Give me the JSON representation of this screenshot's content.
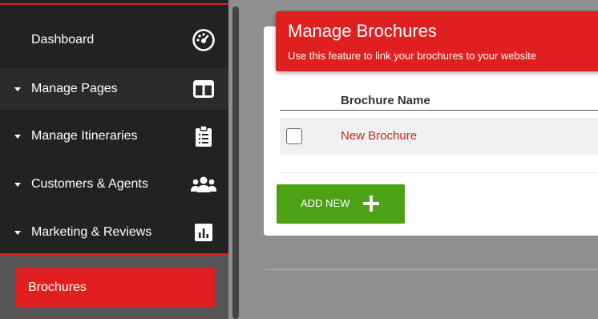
{
  "sidebar": {
    "items": [
      {
        "label": "Dashboard",
        "icon": "dashboard-icon",
        "has_caret": false
      },
      {
        "label": "Manage Pages",
        "icon": "layout-columns-icon",
        "has_caret": true
      },
      {
        "label": "Manage Itineraries",
        "icon": "clipboard-list-icon",
        "has_caret": true
      },
      {
        "label": "Customers & Agents",
        "icon": "users-icon",
        "has_caret": true
      },
      {
        "label": "Marketing & Reviews",
        "icon": "bar-chart-icon",
        "has_caret": true
      }
    ],
    "active_subitem": "Brochures"
  },
  "header": {
    "title": "Manage Brochures",
    "subtitle": "Use this feature to link your brochures to your website"
  },
  "table": {
    "column_header": "Brochure Name",
    "rows": [
      {
        "name": "New Brochure",
        "checked": false
      }
    ]
  },
  "actions": {
    "add_label": "ADD NEW"
  },
  "colors": {
    "accent_red": "#e02020",
    "success_green": "#4ca115",
    "sidebar_bg": "#222222",
    "link_red": "#c22a2a"
  }
}
